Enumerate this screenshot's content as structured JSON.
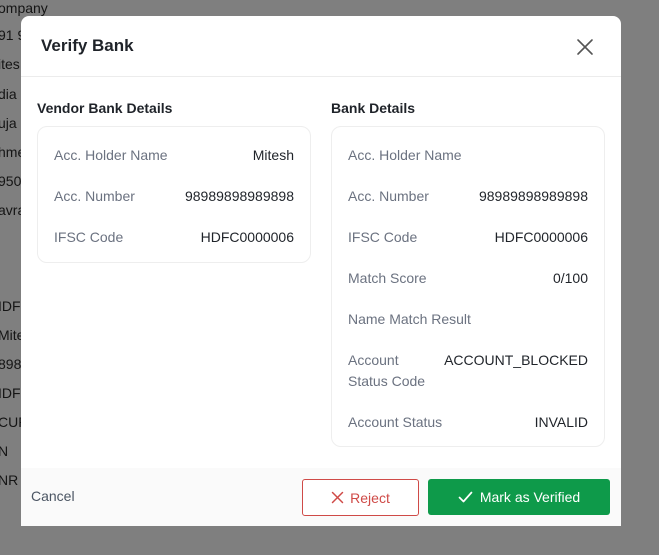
{
  "background_fragments": [
    "ompany",
    "91 9",
    "ites",
    "dia",
    "uja",
    "hme",
    "950",
    "avra",
    "IDF",
    "Mite",
    "898",
    "IDF",
    "CUR",
    "N",
    "NR"
  ],
  "modal": {
    "title": "Verify Bank",
    "vendor_section": {
      "title": "Vendor Bank Details",
      "rows": [
        {
          "label": "Acc. Holder Name",
          "value": "Mitesh"
        },
        {
          "label": "Acc. Number",
          "value": "98989898989898"
        },
        {
          "label": "IFSC Code",
          "value": "HDFC0000006"
        }
      ]
    },
    "bank_section": {
      "title": "Bank Details",
      "rows": [
        {
          "label": "Acc. Holder Name",
          "value": ""
        },
        {
          "label": "Acc. Number",
          "value": "98989898989898"
        },
        {
          "label": "IFSC Code",
          "value": "HDFC0000006"
        },
        {
          "label": "Match Score",
          "value": "0/100"
        },
        {
          "label": "Name Match Result",
          "value": ""
        },
        {
          "label": "Account Status Code",
          "value": "ACCOUNT_BLOCKED"
        },
        {
          "label": "Account Status",
          "value": "INVALID"
        }
      ]
    },
    "footer": {
      "cancel_label": "Cancel",
      "reject_label": "Reject",
      "verify_label": "Mark as Verified"
    }
  },
  "colors": {
    "reject": "#cf4a47",
    "verify": "#0e9a4a"
  },
  "icons": {
    "close": "close-icon",
    "reject": "x-icon",
    "verify": "check-icon"
  }
}
